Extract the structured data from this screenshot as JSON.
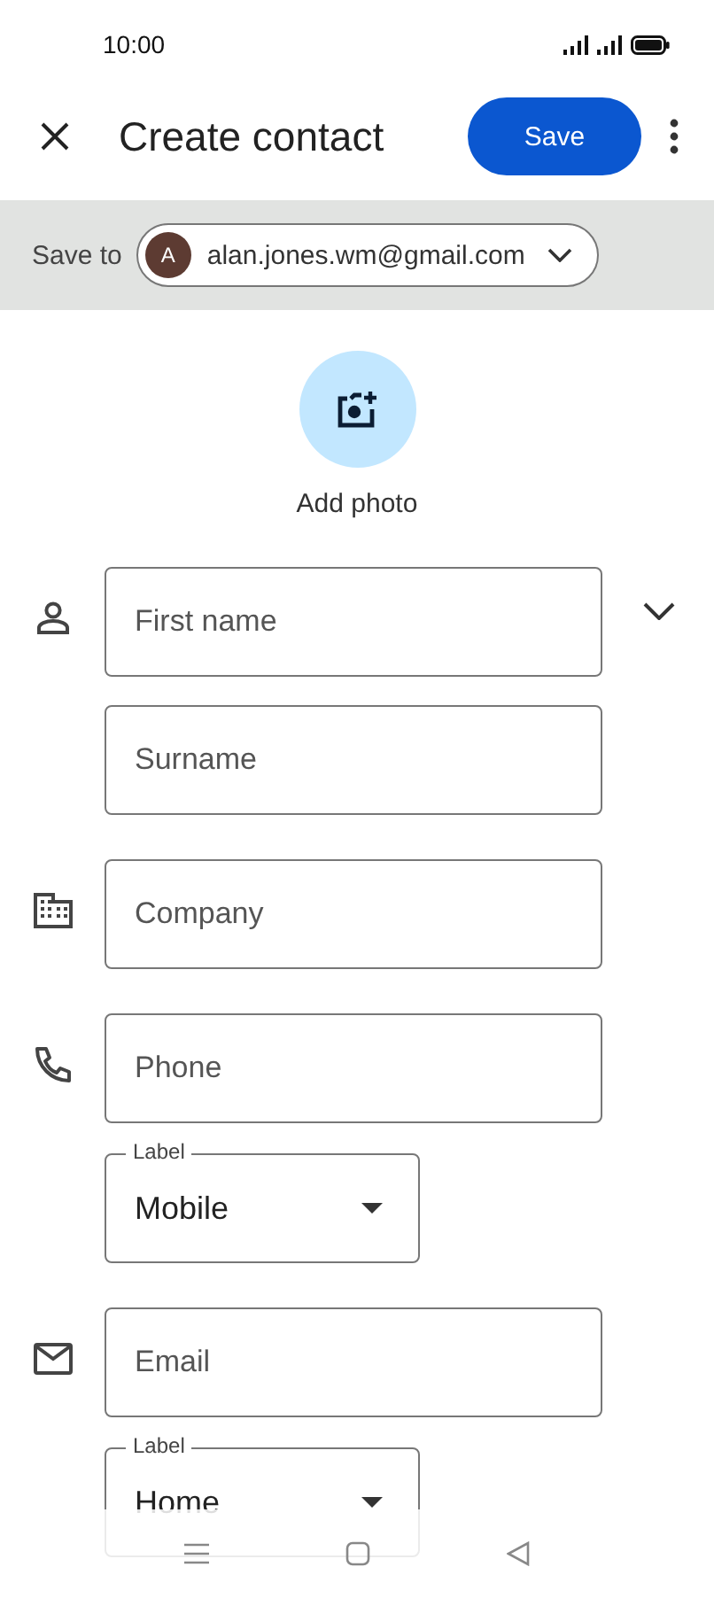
{
  "status_bar": {
    "time": "10:00"
  },
  "app_bar": {
    "title": "Create contact",
    "save_button": "Save"
  },
  "save_to": {
    "label": "Save to",
    "avatar_letter": "A",
    "account": "alan.jones.wm@gmail.com"
  },
  "photo": {
    "label": "Add photo"
  },
  "groups": [
    {
      "expandable": true,
      "fields": [
        {
          "kind": "text",
          "placeholder": "First name"
        },
        {
          "kind": "text",
          "placeholder": "Surname"
        }
      ]
    },
    {
      "expandable": false,
      "fields": [
        {
          "kind": "text",
          "placeholder": "Company"
        }
      ]
    },
    {
      "expandable": false,
      "fields": [
        {
          "kind": "text",
          "placeholder": "Phone"
        },
        {
          "kind": "select",
          "label": "Label",
          "value": "Mobile"
        }
      ]
    },
    {
      "expandable": false,
      "fields": [
        {
          "kind": "text",
          "placeholder": "Email"
        },
        {
          "kind": "select",
          "label": "Label",
          "value": "Home"
        }
      ]
    }
  ]
}
